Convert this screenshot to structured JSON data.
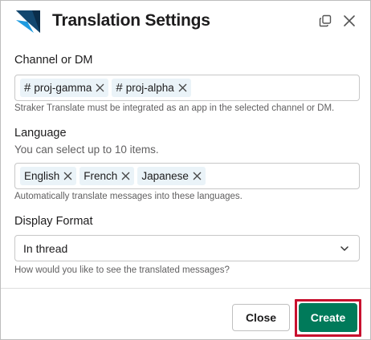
{
  "modal": {
    "title": "Translation Settings",
    "icons": {
      "logo": "straker-logo",
      "copy": "copy-icon",
      "close": "close-icon"
    }
  },
  "channel": {
    "label": "Channel or DM",
    "chips": [
      "proj-gamma",
      "proj-alpha"
    ],
    "hint": "Straker Translate must be integrated as an app in the selected channel or DM."
  },
  "language": {
    "label": "Language",
    "sublabel": "You can select up to 10 items.",
    "chips": [
      "English",
      "French",
      "Japanese"
    ],
    "hint": "Automatically translate messages into these languages."
  },
  "display_format": {
    "label": "Display Format",
    "selected": "In thread",
    "hint": "How would you like to see the translated messages?"
  },
  "footer": {
    "close_label": "Close",
    "create_label": "Create"
  },
  "colors": {
    "primary": "#007a5a",
    "highlight": "#c8102e",
    "chip_bg": "#eaf3f8",
    "logo_dark": "#0a2d4a",
    "logo_light": "#1e9be0"
  }
}
